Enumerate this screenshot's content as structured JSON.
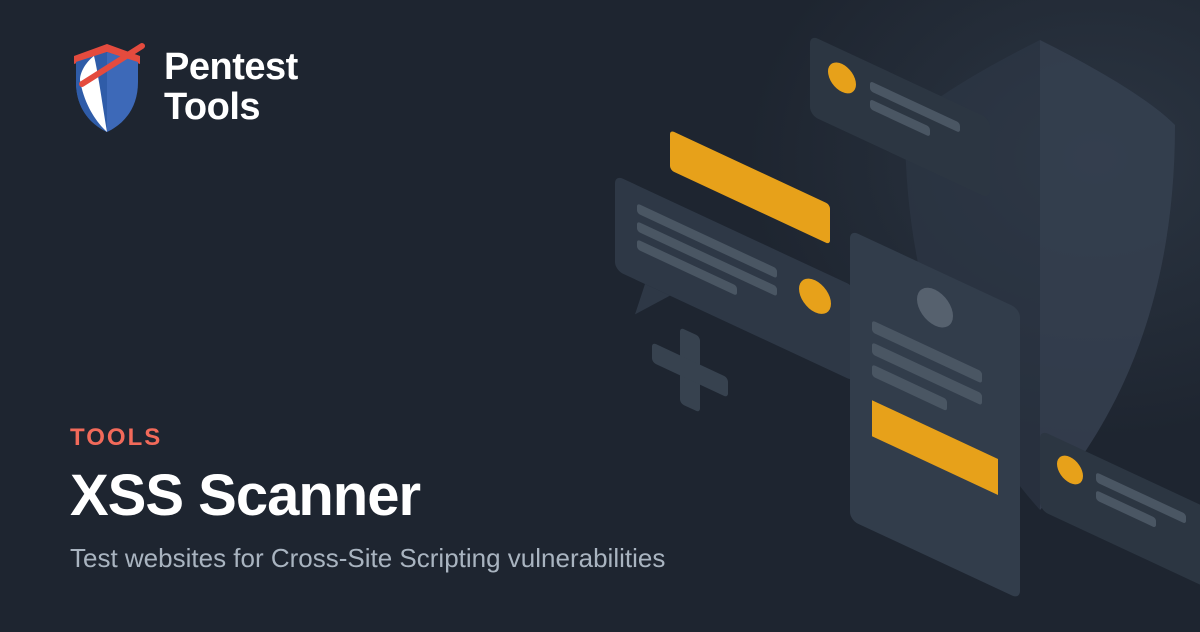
{
  "brand": {
    "line1": "Pentest",
    "line2": "Tools"
  },
  "hero": {
    "eyebrow": "TOOLS",
    "title": "XSS Scanner",
    "subtitle": "Test websites for Cross-Site Scripting vulnerabilities"
  },
  "colors": {
    "bg": "#1e2530",
    "accent_orange": "#e7a11a",
    "accent_red": "#f26a5a",
    "shield_blue": "#3d69b8",
    "text_white": "#ffffff",
    "text_muted": "#a9b4c0",
    "card_dark": "#2c3642",
    "card_darker": "#252e39",
    "line_muted": "#4a5663"
  }
}
